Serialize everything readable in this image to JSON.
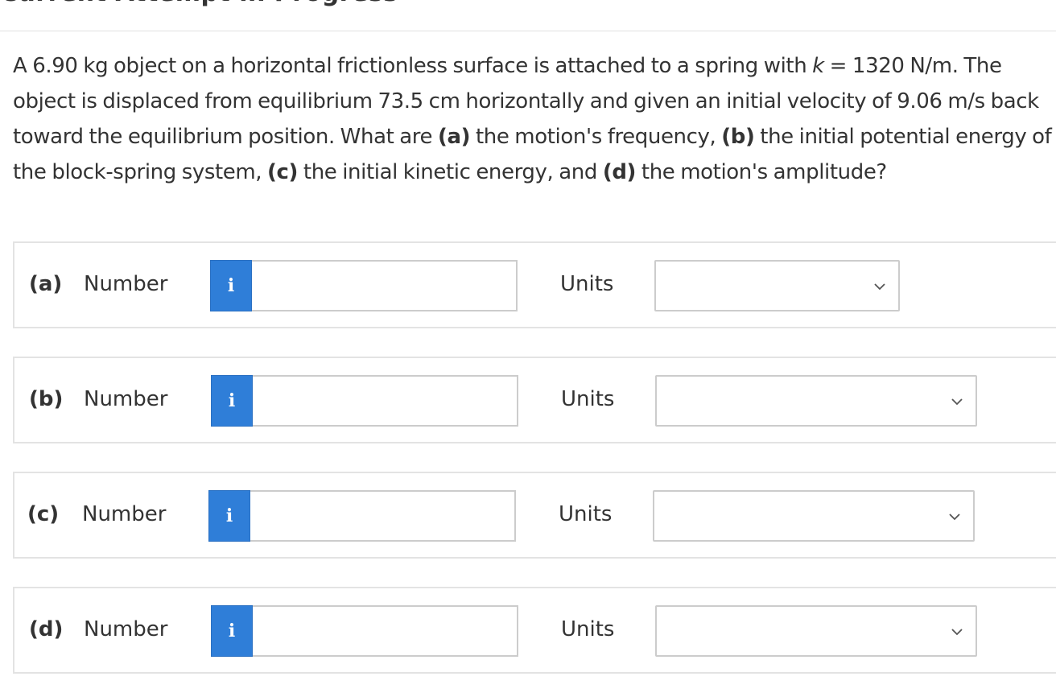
{
  "header": {
    "title": "Current Attempt in Progress"
  },
  "question": {
    "s1": "A 6.90 kg object on a horizontal frictionless surface is attached to a spring with ",
    "k": "k",
    "s2": " = 1320 N/m. The object is displaced from equilibrium 73.5 cm horizontally and given an initial velocity of 9.06 m/s back toward the equilibrium position. What are ",
    "a": "(a)",
    "s3": " the motion's frequency, ",
    "b": "(b)",
    "s4": " the initial potential energy of the block-spring system, ",
    "c": "(c)",
    "s5": " the initial kinetic energy, and ",
    "d": "(d)",
    "s6": " the motion's amplitude?"
  },
  "info_glyph": "i",
  "parts": [
    {
      "label": "(a)",
      "number_label": "Number",
      "value": "",
      "units_label": "Units",
      "units_value": ""
    },
    {
      "label": "(b)",
      "number_label": "Number",
      "value": "",
      "units_label": "Units",
      "units_value": ""
    },
    {
      "label": "(c)",
      "number_label": "Number",
      "value": "",
      "units_label": "Units",
      "units_value": ""
    },
    {
      "label": "(d)",
      "number_label": "Number",
      "value": "",
      "units_label": "Units",
      "units_value": ""
    }
  ],
  "colors": {
    "info_button": "#2f7ed8",
    "border": "#e3e3e3",
    "input_border": "#cccccc",
    "text": "#333333"
  }
}
